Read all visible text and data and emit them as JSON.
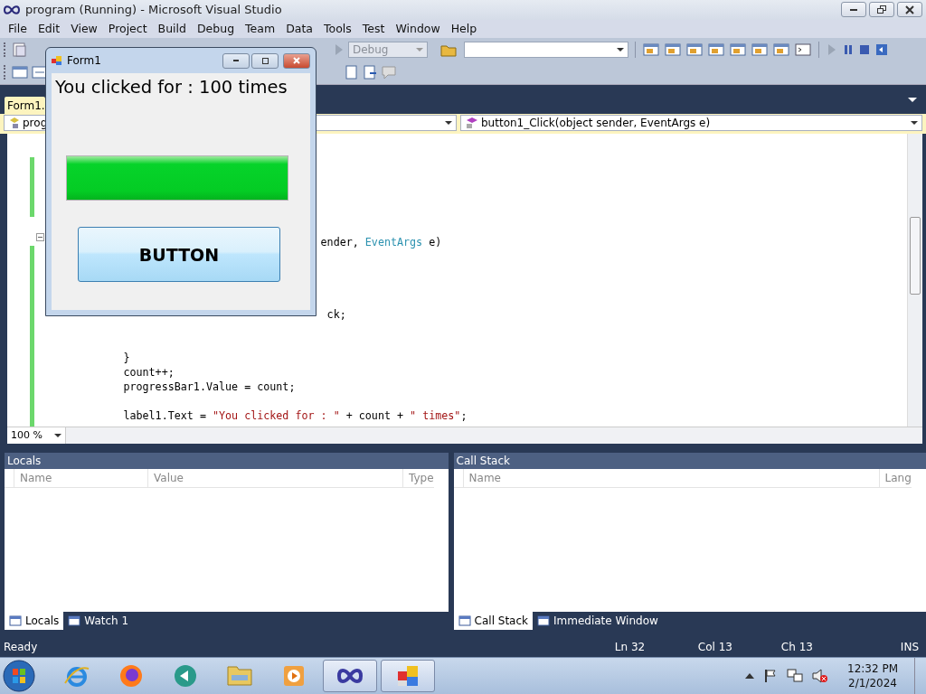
{
  "window": {
    "title": "program (Running) - Microsoft Visual Studio"
  },
  "menu": [
    "File",
    "Edit",
    "View",
    "Project",
    "Build",
    "Debug",
    "Team",
    "Data",
    "Tools",
    "Test",
    "Window",
    "Help"
  ],
  "toolbar": {
    "configuration": "Debug"
  },
  "document_tabs": [
    {
      "label": "Form1.",
      "selected": true
    }
  ],
  "navigation": {
    "type_combo": "prog",
    "member_combo": "button1_Click(object sender, EventArgs e)"
  },
  "code_lines": [
    {
      "spans": [
        {
          "kind": "plain",
          "text": "                                           ender, "
        },
        {
          "kind": "type",
          "text": "EventArgs"
        },
        {
          "kind": "plain",
          "text": " e)"
        }
      ]
    },
    {
      "spans": [
        {
          "kind": "plain",
          "text": "                                            ck;"
        }
      ]
    },
    {
      "spans": [
        {
          "kind": "plain",
          "text": "            }"
        }
      ]
    },
    {
      "spans": [
        {
          "kind": "plain",
          "text": "            count++;"
        }
      ]
    },
    {
      "spans": [
        {
          "kind": "plain",
          "text": "            progressBar1.Value = count;"
        }
      ]
    },
    {
      "spans": [
        {
          "kind": "plain",
          "text": "            label1.Text = "
        },
        {
          "kind": "string",
          "text": "\"You clicked for : \""
        },
        {
          "kind": "plain",
          "text": " + count + "
        },
        {
          "kind": "string",
          "text": "\" times\""
        },
        {
          "kind": "plain",
          "text": ";"
        }
      ]
    }
  ],
  "zoom": "100 %",
  "form": {
    "title": "Form1",
    "label": "You clicked for : 100 times",
    "progress": {
      "level": 1
    },
    "button": "BUTTON"
  },
  "panels": [
    {
      "title": "Locals",
      "columns": [
        "Name",
        "Value",
        "Type"
      ],
      "tabs": [
        {
          "label": "Locals",
          "selected": true
        },
        {
          "label": "Watch 1",
          "selected": false
        }
      ]
    },
    {
      "title": "Call Stack",
      "columns": [
        "Name",
        "Lang"
      ],
      "tabs": [
        {
          "label": "Call Stack",
          "selected": true
        },
        {
          "label": "Immediate Window",
          "selected": false
        }
      ]
    }
  ],
  "status_bar": {
    "message": "Ready",
    "line": "Ln 32",
    "column": "Col 13",
    "char": "Ch 13",
    "mode": "INS"
  },
  "taskbar": {
    "apps": [
      {
        "kind": "browser",
        "selected": false
      },
      {
        "kind": "firefox",
        "selected": false
      },
      {
        "kind": "circle-arrow",
        "selected": false
      },
      {
        "kind": "folder",
        "selected": false
      },
      {
        "kind": "media",
        "selected": false
      },
      {
        "kind": "vs",
        "selected": true
      },
      {
        "kind": "form",
        "selected": true
      }
    ],
    "clock": {
      "time": "12:32 PM",
      "date": "2/1/2024"
    }
  }
}
